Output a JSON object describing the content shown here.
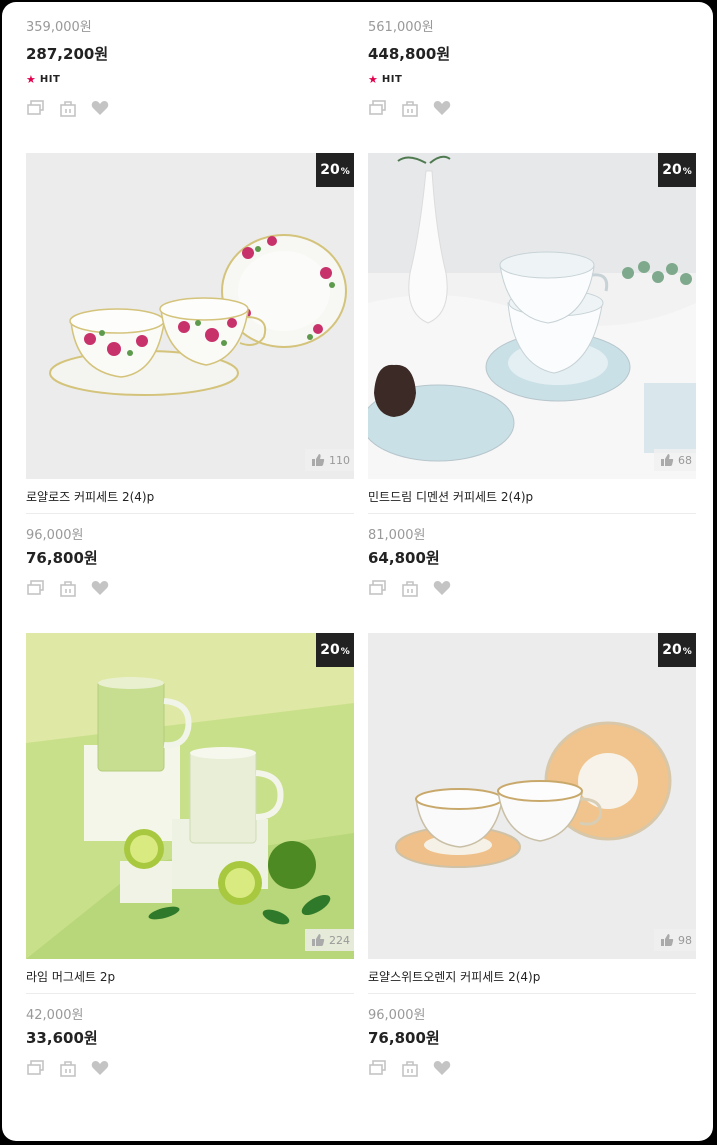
{
  "top_row": [
    {
      "old_price": "359,000원",
      "price": "287,200원",
      "hit": "HIT"
    },
    {
      "old_price": "561,000원",
      "price": "448,800원",
      "hit": "HIT"
    }
  ],
  "products": [
    {
      "name": "로얄로즈 커피세트 2(4)p",
      "old_price": "96,000원",
      "price": "76,800원",
      "discount": "20",
      "discount_unit": "%",
      "likes": "110"
    },
    {
      "name": "민트드림 디멘션 커피세트 2(4)p",
      "old_price": "81,000원",
      "price": "64,800원",
      "discount": "20",
      "discount_unit": "%",
      "likes": "68"
    },
    {
      "name": "라임 머그세트 2p",
      "old_price": "42,000원",
      "price": "33,600원",
      "discount": "20",
      "discount_unit": "%",
      "likes": "224"
    },
    {
      "name": "로얄스위트오렌지 커피세트 2(4)p",
      "old_price": "96,000원",
      "price": "76,800원",
      "discount": "20",
      "discount_unit": "%",
      "likes": "98"
    }
  ],
  "icons": {
    "compare": "compare-icon",
    "cart": "cart-icon",
    "wishlist": "heart-icon",
    "like": "thumbs-up-icon",
    "hit": "star-icon"
  },
  "colors": {
    "hit_star": "#e0004d",
    "badge_bg": "#222222",
    "icon_gray": "#c4c4c4"
  }
}
